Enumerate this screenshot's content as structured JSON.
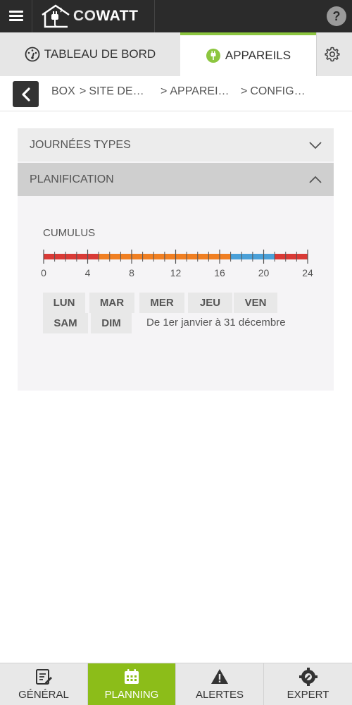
{
  "header": {
    "logo_prefix": "CO",
    "logo_suffix": "WATT",
    "menu_icon": "hamburger-icon",
    "help_icon": "question-icon"
  },
  "tabs": {
    "dashboard_label": "TABLEAU DE BORD",
    "devices_label": "APPAREILS",
    "active": "APPAREILS",
    "accent_color": "#8cc63f"
  },
  "breadcrumb": {
    "items": [
      "BOX",
      "SITE DE…",
      "APPAREI…",
      "CONFIG…"
    ],
    "separator": ">"
  },
  "accordion": {
    "journees_label": "JOURNÉES TYPES",
    "planification_label": "PLANIFICATION"
  },
  "planning": {
    "device_label": "CUMULUS",
    "ticks": [
      "0",
      "4",
      "8",
      "12",
      "16",
      "20",
      "24"
    ],
    "segments": [
      {
        "start": 0,
        "end": 5,
        "color": "#d93a36"
      },
      {
        "start": 5,
        "end": 17,
        "color": "#f07f22"
      },
      {
        "start": 17,
        "end": 21,
        "color": "#4aa0d8"
      },
      {
        "start": 21,
        "end": 24,
        "color": "#d93a36"
      }
    ],
    "days_row1": [
      "LUN",
      "MAR",
      "MER",
      "JEU",
      "VEN"
    ],
    "days_row2": [
      "SAM",
      "DIM"
    ],
    "date_range": "De 1er janvier à 31 décembre"
  },
  "bottom_nav": {
    "general": "GÉNÉRAL",
    "planning": "PLANNING",
    "alertes": "ALERTES",
    "expert": "EXPERT",
    "active_color": "#8cbd19"
  }
}
